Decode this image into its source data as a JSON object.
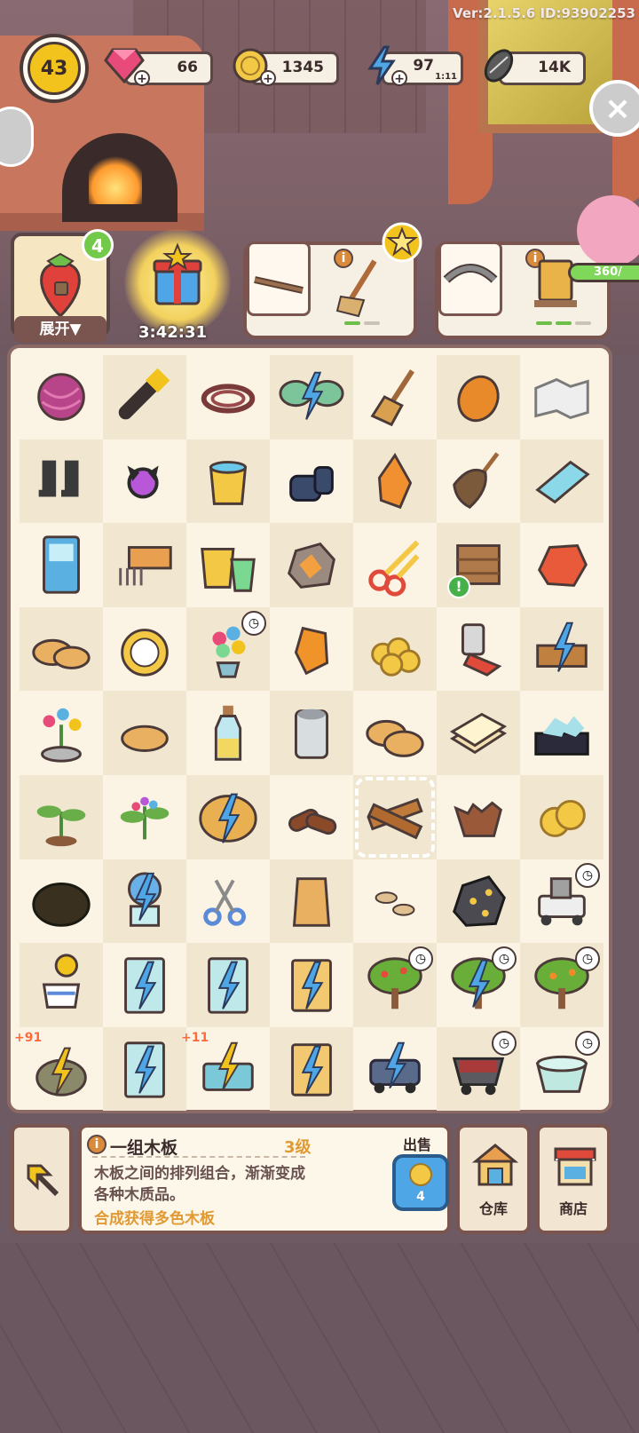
{
  "version": "Ver:2.1.5.6 ID:93902253",
  "player": {
    "level": "43"
  },
  "resources": {
    "gems": "66",
    "coins": "1345",
    "energy": "97",
    "energy_timer": "1:11",
    "seeds": "14K"
  },
  "top": {
    "stack_count": "4",
    "expand_label": "展开▼",
    "gift_timer": "3:42:31",
    "piggy_progress": "360/"
  },
  "info": {
    "title": "一组木板",
    "level": "3级",
    "desc": "木板之间的排列组合，渐渐变成各种木质品。",
    "hint": "合成获得多色木板",
    "sell_label": "出售",
    "sell_price": "4"
  },
  "buttons": {
    "warehouse": "仓库",
    "shop": "商店"
  },
  "board": {
    "bonus_1": "+91",
    "bonus_2": "+11"
  },
  "colors": {
    "accent": "#e19a33",
    "board_bg": "#fbf3e3",
    "frame": "#7a5550",
    "energy": "#4fa6e6"
  }
}
